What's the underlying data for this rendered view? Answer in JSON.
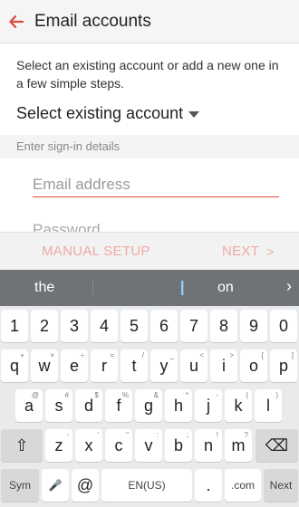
{
  "header": {
    "title": "Email accounts"
  },
  "description": "Select an existing account or add a new one in a few simple steps.",
  "select_existing": "Select existing account",
  "section_header": "Enter sign-in details",
  "fields": {
    "email_placeholder": "Email address",
    "password_placeholder": "Password"
  },
  "actions": {
    "manual_setup": "MANUAL SETUP",
    "next": "NEXT",
    "next_icon": ">"
  },
  "keyboard": {
    "suggestions": [
      "the",
      "on"
    ],
    "number_row": [
      "1",
      "2",
      "3",
      "4",
      "5",
      "6",
      "7",
      "8",
      "9",
      "0"
    ],
    "row1": [
      {
        "k": "q",
        "s": "+"
      },
      {
        "k": "w",
        "s": "×"
      },
      {
        "k": "e",
        "s": "÷"
      },
      {
        "k": "r",
        "s": "="
      },
      {
        "k": "t",
        "s": "/"
      },
      {
        "k": "y",
        "s": "_"
      },
      {
        "k": "u",
        "s": "<"
      },
      {
        "k": "i",
        "s": ">"
      },
      {
        "k": "o",
        "s": "["
      },
      {
        "k": "p",
        "s": "]"
      }
    ],
    "row2": [
      {
        "k": "a",
        "s": "@"
      },
      {
        "k": "s",
        "s": "#"
      },
      {
        "k": "d",
        "s": "$"
      },
      {
        "k": "f",
        "s": "%"
      },
      {
        "k": "g",
        "s": "&"
      },
      {
        "k": "h",
        "s": "*"
      },
      {
        "k": "j",
        "s": "-"
      },
      {
        "k": "k",
        "s": "("
      },
      {
        "k": "l",
        "s": ")"
      }
    ],
    "row3": [
      {
        "k": "z",
        "s": "-"
      },
      {
        "k": "x",
        "s": "'"
      },
      {
        "k": "c",
        "s": "\""
      },
      {
        "k": "v",
        "s": ":"
      },
      {
        "k": "b",
        "s": ";"
      },
      {
        "k": "n",
        "s": "!"
      },
      {
        "k": "m",
        "s": "?"
      }
    ],
    "shift_icon": "⇧",
    "backspace_icon": "⌫",
    "bottom": {
      "sym": "Sym",
      "mic_icon": "🎤",
      "at": "@",
      "lang": "EN(US)",
      "dot": ".",
      "com": ".com",
      "next": "Next"
    }
  },
  "colors": {
    "accent": "#e04a40",
    "disabled_accent": "#f0a8a0",
    "suggestion_bar": "#6f7378"
  }
}
